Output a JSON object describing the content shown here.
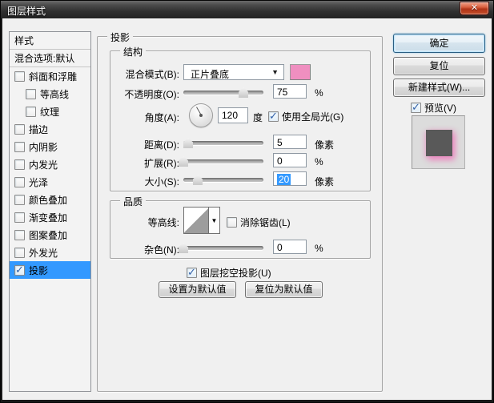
{
  "window": {
    "title": "图层样式",
    "close_glyph": "✕"
  },
  "sidebar": {
    "items": [
      {
        "label": "样式",
        "checked": false
      },
      {
        "label": "混合选项:默认",
        "checked": false
      },
      {
        "label": "斜面和浮雕",
        "checked": false
      },
      {
        "label": "等高线",
        "checked": false
      },
      {
        "label": "纹理",
        "checked": false
      },
      {
        "label": "描边",
        "checked": false
      },
      {
        "label": "内阴影",
        "checked": false
      },
      {
        "label": "内发光",
        "checked": false
      },
      {
        "label": "光泽",
        "checked": false
      },
      {
        "label": "颜色叠加",
        "checked": false
      },
      {
        "label": "渐变叠加",
        "checked": false
      },
      {
        "label": "图案叠加",
        "checked": false
      },
      {
        "label": "外发光",
        "checked": false
      },
      {
        "label": "投影",
        "checked": true
      }
    ]
  },
  "main": {
    "group_title": "投影",
    "structure": {
      "title": "结构",
      "blend_mode": {
        "label": "混合模式(B):",
        "value": "正片叠底",
        "arrow": "▼"
      },
      "opacity": {
        "label": "不透明度(O):",
        "value": "75",
        "unit": "%",
        "slider_percent": 75
      },
      "angle": {
        "label": "角度(A):",
        "value": "120",
        "unit": "度",
        "degrees": 120,
        "global_light": {
          "label": "使用全局光(G)",
          "checked": true
        }
      },
      "distance": {
        "label": "距离(D):",
        "value": "5",
        "unit": "像素",
        "slider_percent": 6
      },
      "spread": {
        "label": "扩展(R):",
        "value": "0",
        "unit": "%",
        "slider_percent": 0
      },
      "size": {
        "label": "大小(S):",
        "value": "20",
        "unit": "像素",
        "slider_percent": 18,
        "value_selected": true
      }
    },
    "quality": {
      "title": "品质",
      "contour": {
        "label": "等高线:",
        "arrow": "▼",
        "antialias": {
          "label": "消除锯齿(L)",
          "checked": false
        }
      },
      "noise": {
        "label": "杂色(N):",
        "value": "0",
        "unit": "%",
        "slider_percent": 0
      }
    },
    "knockout": {
      "label": "图层挖空投影(U)",
      "checked": true
    },
    "footer_buttons": {
      "make_default": "设置为默认值",
      "reset_default": "复位为默认值"
    }
  },
  "actions": {
    "ok": "确定",
    "reset": "复位",
    "new_style": "新建样式(W)...",
    "preview": {
      "label": "预览(V)",
      "checked": true
    }
  },
  "colors": {
    "selection_blue": "#3399ff",
    "shadow_swatch_pink": "#ef8fc0",
    "preview_square_gray": "#595959",
    "preview_glow_pink": "#ec82be"
  }
}
